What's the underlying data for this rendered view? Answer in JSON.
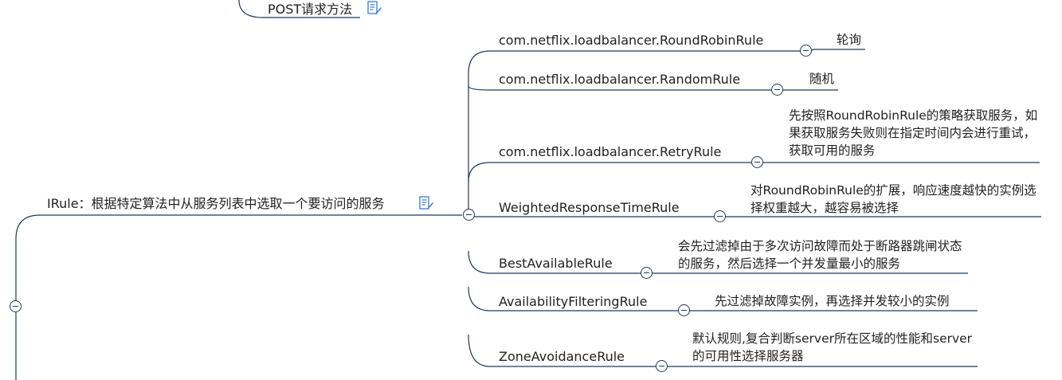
{
  "top_fragment": {
    "label": "POST请求方法"
  },
  "parent": {
    "label": "IRule：根据特定算法中从服务列表中选取一个要访问的服务"
  },
  "rules": [
    {
      "name": "com.netflix.loadbalancer.RoundRobinRule",
      "desc": "轮询"
    },
    {
      "name": "com.netflix.loadbalancer.RandomRule",
      "desc": "随机"
    },
    {
      "name": "com.netflix.loadbalancer.RetryRule",
      "desc": "先按照RoundRobinRule的策略获取服务，如果获取服务失败则在指定时间内会进行重试，获取可用的服务"
    },
    {
      "name": "WeightedResponseTimeRule",
      "desc": "对RoundRobinRule的扩展，响应速度越快的实例选择权重越大，越容易被选择"
    },
    {
      "name": "BestAvailableRule",
      "desc": "会先过滤掉由于多次访问故障而处于断路器跳闸状态的服务，然后选择一个并发量最小的服务"
    },
    {
      "name": "AvailabilityFilteringRule",
      "desc": "先过滤掉故障实例，再选择并发较小的实例"
    },
    {
      "name": "ZoneAvoidanceRule",
      "desc": "默认规则,复合判断server所在区域的性能和server的可用性选择服务器"
    }
  ],
  "colors": {
    "line": "#1f3a5a",
    "icon": "#3a7bd5"
  }
}
